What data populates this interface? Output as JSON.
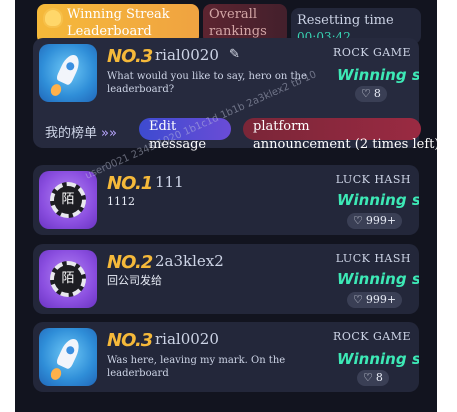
{
  "tabs": {
    "winning": "Winning Streak Leaderboard",
    "overall": "Overall rankings"
  },
  "reset": {
    "label": "Resetting time",
    "timer": "00:03:42"
  },
  "mine": {
    "rank": "NO.3",
    "name": "rial0020",
    "message": "What would you like to say, hero on the leaderboard?",
    "game": "ROCK GAME",
    "streak": "Winning str",
    "likes": "8",
    "my_board": "我的榜单",
    "edit_line1": "Edit",
    "edit_line2": "message",
    "plat_line1": "platform",
    "plat_line2": "announcement (2 times left)"
  },
  "rows": [
    {
      "rank": "NO.1",
      "name": "111",
      "message": "1112",
      "game": "LUCK HASH",
      "streak": "Winning str",
      "likes": "999+"
    },
    {
      "rank": "NO.2",
      "name": "2a3klex2",
      "message": "回公司发给",
      "game": "LUCK HASH",
      "streak": "Winning str",
      "likes": "999+"
    },
    {
      "rank": "NO.3",
      "name": "rial0020",
      "message": "Was here, leaving my mark. On the leaderboard",
      "game": "ROCK GAME",
      "streak": "Winning str",
      "likes": "8"
    }
  ],
  "icons": {
    "chip": "陌"
  },
  "watermark": "user0021 2345 1020 1b1c1d 1b1b 2a3klex2 tb 10",
  "colors": {
    "gold": "#f5b93a",
    "teal": "#3de9b6",
    "card": "#23273a",
    "background": "#12141f"
  }
}
